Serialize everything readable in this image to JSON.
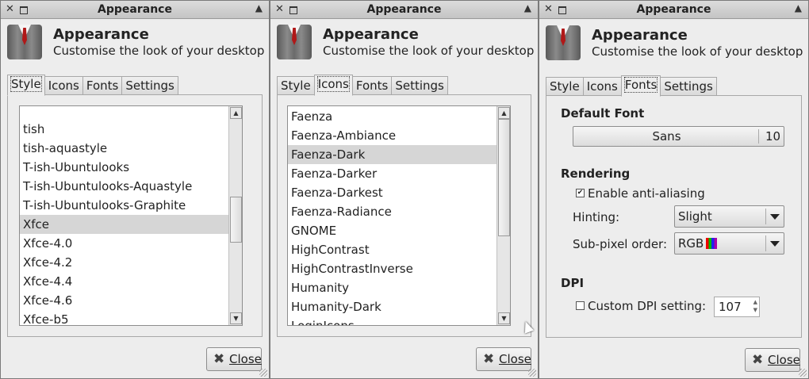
{
  "windows": [
    {
      "title": "Appearance",
      "header_title": "Appearance",
      "header_subtitle": "Customise the look of your desktop",
      "tabs": [
        "Style",
        "Icons",
        "Fonts",
        "Settings"
      ],
      "active_tab": "Style",
      "list_items": [
        "tish",
        "tish-aquastyle",
        "T-ish-Ubuntulooks",
        "T-ish-Ubuntulooks-Aquastyle",
        "T-ish-Ubuntulooks-Graphite",
        "Xfce",
        "Xfce-4.0",
        "Xfce-4.2",
        "Xfce-4.4",
        "Xfce-4.6",
        "Xfce-b5"
      ],
      "selected_item": "Xfce",
      "close_label": "Close"
    },
    {
      "title": "Appearance",
      "header_title": "Appearance",
      "header_subtitle": "Customise the look of your desktop",
      "tabs": [
        "Style",
        "Icons",
        "Fonts",
        "Settings"
      ],
      "active_tab": "Icons",
      "list_items": [
        "Faenza",
        "Faenza-Ambiance",
        "Faenza-Dark",
        "Faenza-Darker",
        "Faenza-Darkest",
        "Faenza-Radiance",
        "GNOME",
        "HighContrast",
        "HighContrastInverse",
        "Humanity",
        "Humanity-Dark",
        "LoginIcons"
      ],
      "selected_item": "Faenza-Dark",
      "close_label": "Close"
    },
    {
      "title": "Appearance",
      "header_title": "Appearance",
      "header_subtitle": "Customise the look of your desktop",
      "tabs": [
        "Style",
        "Icons",
        "Fonts",
        "Settings"
      ],
      "active_tab": "Fonts",
      "fonts": {
        "default_font_heading": "Default Font",
        "font_name": "Sans",
        "font_size": "10",
        "rendering_heading": "Rendering",
        "antialias_label": "Enable anti-aliasing",
        "antialias_checked": true,
        "hinting_label": "Hinting:",
        "hinting_value": "Slight",
        "subpixel_label": "Sub-pixel order:",
        "subpixel_value": "RGB",
        "dpi_heading": "DPI",
        "custom_dpi_label": "Custom DPI setting:",
        "custom_dpi_checked": false,
        "dpi_value": "107"
      },
      "close_label": "Close"
    }
  ]
}
